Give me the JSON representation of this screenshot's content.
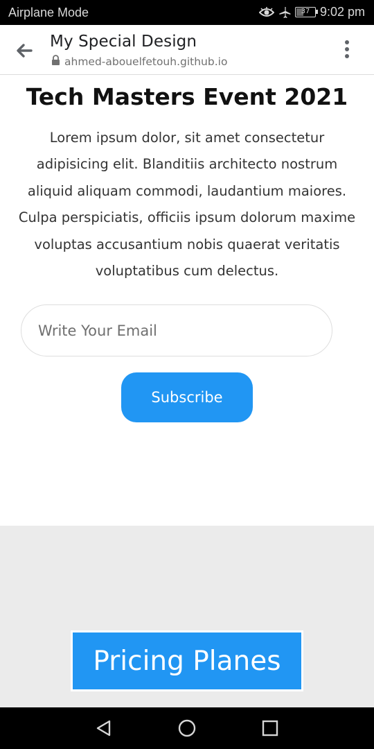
{
  "status_bar": {
    "mode": "Airplane Mode",
    "battery": "37",
    "battery_level": 0.37,
    "time": "9:02 pm",
    "icons": [
      "eye-icon",
      "airplane-icon",
      "battery-icon"
    ]
  },
  "browser": {
    "title": "My Special Design",
    "url": "ahmed-abouelfetouh.github.io",
    "icons": [
      "back-arrow-icon",
      "lock-icon",
      "more-vert-icon"
    ]
  },
  "hero": {
    "title": "Tech Masters Event 2021",
    "text": "Lorem ipsum dolor, sit amet consectetur adipisicing elit. Blanditiis architecto nostrum aliquid aliquam commodi, laudantium maiores. Culpa perspiciatis, officiis ipsum dolorum maxime voluptas accusantium nobis quaerat veritatis voluptatibus cum delectus."
  },
  "subscribe": {
    "email_placeholder": "Write Your Email",
    "email_value": "",
    "button_label": "Subscribe"
  },
  "pricing": {
    "button_label": "Pricing Planes"
  },
  "nav": {
    "icons": [
      "back-triangle-icon",
      "home-circle-icon",
      "recents-square-icon"
    ]
  },
  "colors": {
    "accent": "#2196f3",
    "section_gray": "#ebebeb"
  }
}
